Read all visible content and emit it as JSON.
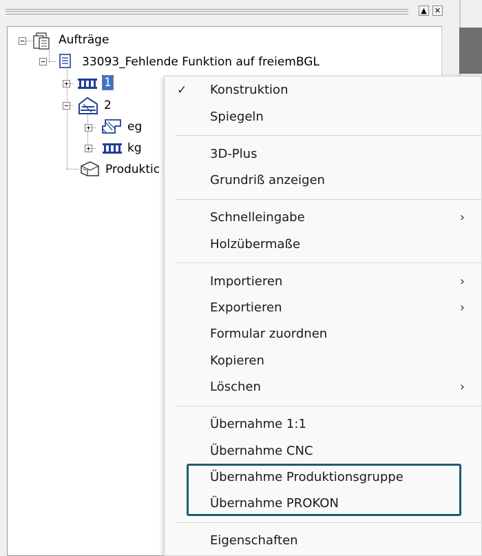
{
  "window": {
    "restore_label": "▲",
    "close_label": "✕"
  },
  "tree": {
    "root": {
      "label": "Aufträge",
      "expand": "−"
    },
    "order": {
      "label": "33093_Fehlende Funktion auf freiemBGL",
      "expand": "−"
    },
    "node1": {
      "label": "1",
      "expand": "+"
    },
    "node2": {
      "label": "2",
      "expand": "−"
    },
    "eg": {
      "label": "eg",
      "expand": "+"
    },
    "kg": {
      "label": "kg",
      "expand": "+"
    },
    "production": {
      "label": "Produktic"
    }
  },
  "menu": {
    "check_mark": "✓",
    "chevron": "›",
    "items": [
      {
        "label": "Konstruktion"
      },
      {
        "label": "Spiegeln"
      },
      {
        "label": "3D-Plus"
      },
      {
        "label": "Grundriß anzeigen"
      },
      {
        "label": "Schnelleingabe"
      },
      {
        "label": "Holzübermaße"
      },
      {
        "label": "Importieren"
      },
      {
        "label": "Exportieren"
      },
      {
        "label": "Formular zuordnen"
      },
      {
        "label": "Kopieren"
      },
      {
        "label": "Löschen"
      },
      {
        "label": "Übernahme 1:1"
      },
      {
        "label": "Übernahme CNC"
      },
      {
        "label": "Übernahme Produktionsgruppe"
      },
      {
        "label": "Übernahme PROKON"
      },
      {
        "label": "Eigenschaften"
      }
    ]
  },
  "colors": {
    "highlight_border": "#1e5b6e",
    "selection": "#3b73c9",
    "icon_blue": "#1f3f9a"
  }
}
